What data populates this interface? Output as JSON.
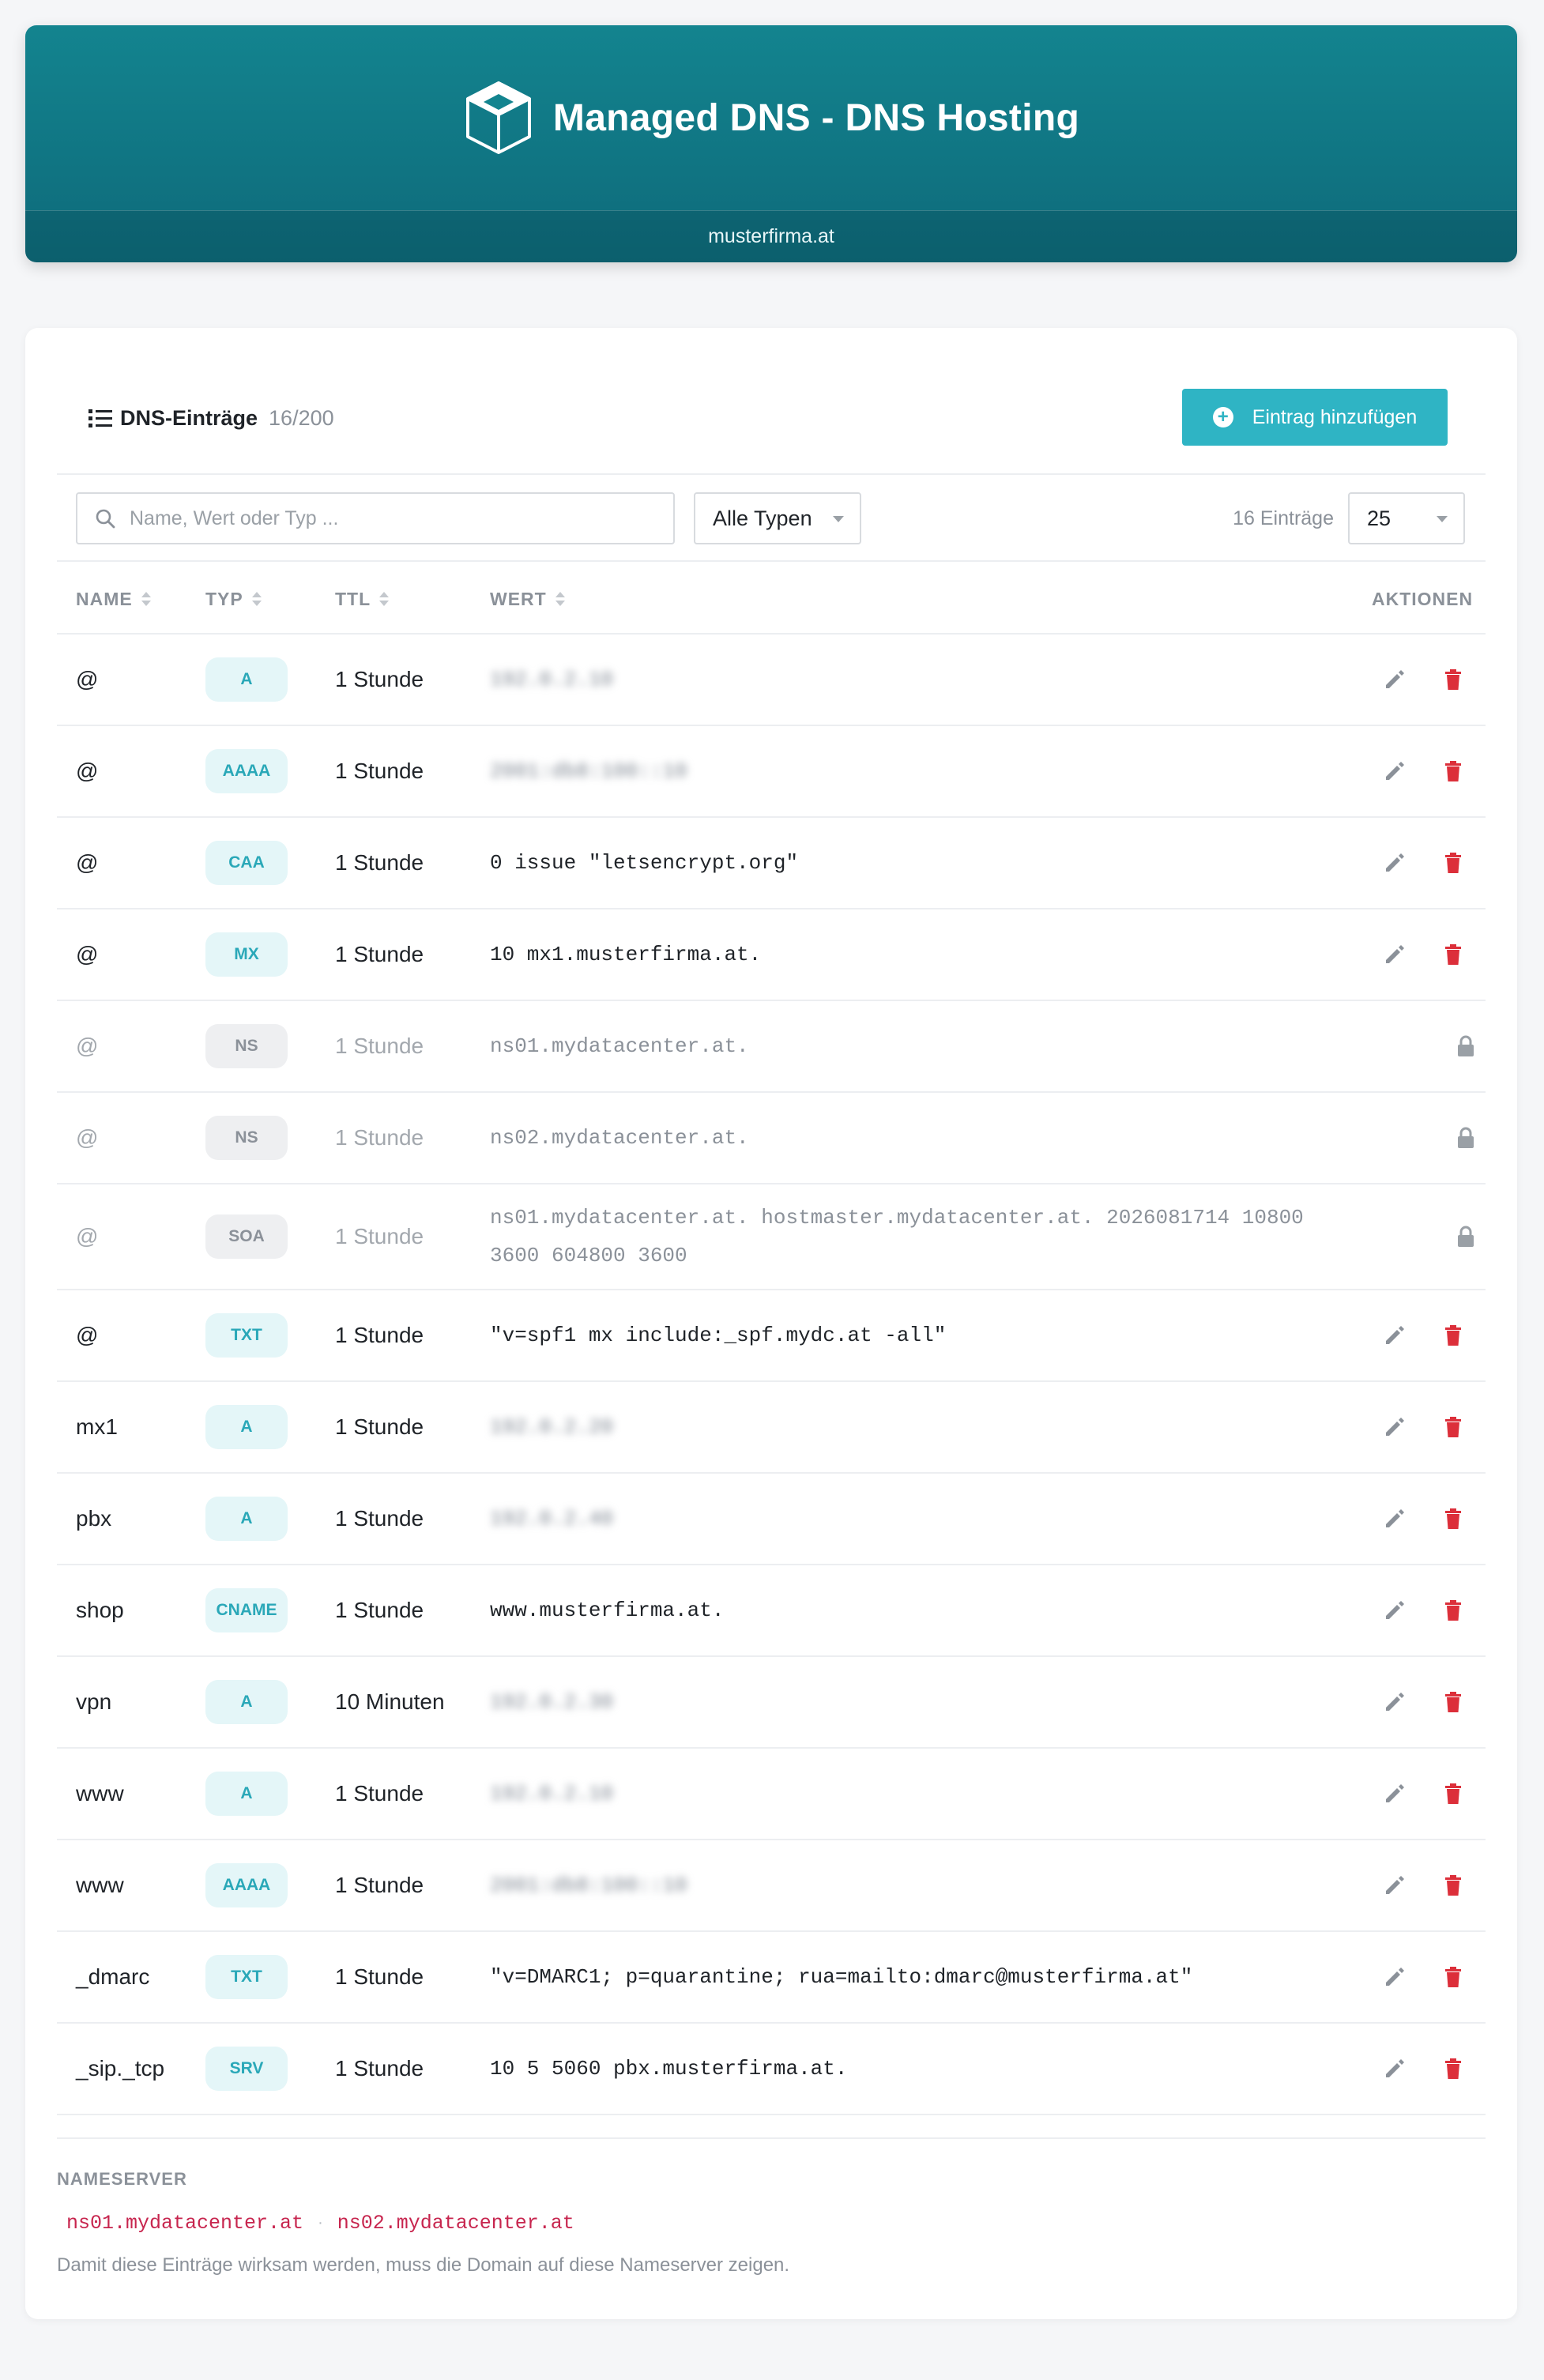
{
  "header": {
    "title": "Managed DNS - DNS Hosting",
    "domain": "musterfirma.at"
  },
  "card": {
    "title": "DNS-Einträge",
    "count": "16/200",
    "add_button": "Eintrag hinzufügen"
  },
  "filters": {
    "search_placeholder": "Name, Wert oder Typ ...",
    "type_select": "Alle Typen",
    "entries_label": "16 Einträge",
    "page_size": "25"
  },
  "table": {
    "columns": [
      "NAME",
      "TYP",
      "TTL",
      "WERT",
      "AKTIONEN"
    ],
    "rows": [
      {
        "name": "@",
        "type": "A",
        "ttl": "1 Stunde",
        "value": "192.0.2.10",
        "blurred": true,
        "locked": false
      },
      {
        "name": "@",
        "type": "AAAA",
        "ttl": "1 Stunde",
        "value": "2001:db8:100::10",
        "blurred": true,
        "locked": false
      },
      {
        "name": "@",
        "type": "CAA",
        "ttl": "1 Stunde",
        "value": "0 issue \"letsencrypt.org\"",
        "blurred": false,
        "locked": false
      },
      {
        "name": "@",
        "type": "MX",
        "ttl": "1 Stunde",
        "value": "10 mx1.musterfirma.at.",
        "blurred": false,
        "locked": false
      },
      {
        "name": "@",
        "type": "NS",
        "ttl": "1 Stunde",
        "value": "ns01.mydatacenter.at.",
        "blurred": false,
        "locked": true
      },
      {
        "name": "@",
        "type": "NS",
        "ttl": "1 Stunde",
        "value": "ns02.mydatacenter.at.",
        "blurred": false,
        "locked": true
      },
      {
        "name": "@",
        "type": "SOA",
        "ttl": "1 Stunde",
        "value": "ns01.mydatacenter.at. hostmaster.mydatacenter.at. 2026081714 10800 3600 604800 3600",
        "blurred": false,
        "locked": true
      },
      {
        "name": "@",
        "type": "TXT",
        "ttl": "1 Stunde",
        "value": "\"v=spf1 mx include:_spf.mydc.at -all\"",
        "blurred": false,
        "locked": false
      },
      {
        "name": "mx1",
        "type": "A",
        "ttl": "1 Stunde",
        "value": "192.0.2.20",
        "blurred": true,
        "locked": false
      },
      {
        "name": "pbx",
        "type": "A",
        "ttl": "1 Stunde",
        "value": "192.0.2.40",
        "blurred": true,
        "locked": false
      },
      {
        "name": "shop",
        "type": "CNAME",
        "ttl": "1 Stunde",
        "value": "www.musterfirma.at.",
        "blurred": false,
        "locked": false
      },
      {
        "name": "vpn",
        "type": "A",
        "ttl": "10 Minuten",
        "value": "192.0.2.30",
        "blurred": true,
        "locked": false
      },
      {
        "name": "www",
        "type": "A",
        "ttl": "1 Stunde",
        "value": "192.0.2.10",
        "blurred": true,
        "locked": false
      },
      {
        "name": "www",
        "type": "AAAA",
        "ttl": "1 Stunde",
        "value": "2001:db8:100::10",
        "blurred": true,
        "locked": false
      },
      {
        "name": "_dmarc",
        "type": "TXT",
        "ttl": "1 Stunde",
        "value": "\"v=DMARC1; p=quarantine; rua=mailto:dmarc@musterfirma.at\"",
        "blurred": false,
        "locked": false
      },
      {
        "name": "_sip._tcp",
        "type": "SRV",
        "ttl": "1 Stunde",
        "value": "10 5 5060 pbx.musterfirma.at.",
        "blurred": false,
        "locked": false
      }
    ]
  },
  "nameserver": {
    "title": "NAMESERVER",
    "servers": [
      "ns01.mydatacenter.at",
      "ns02.mydatacenter.at"
    ],
    "separator": "·",
    "note": "Damit diese Einträge wirksam werden, muss die Domain auf diese Nameserver zeigen."
  },
  "colors": {
    "header_top": "#13848f",
    "header_bottom": "#0e6a7a",
    "accent": "#2fb4c4",
    "badge_bg": "#e4f6f8",
    "badge_text": "#2aa8b8",
    "delete": "#dc2f3a",
    "edit": "#8b9199",
    "nameserver_text": "#c7254e"
  },
  "icons": {
    "logo": "cube-icon",
    "list": "list-icon",
    "add": "plus-circle-icon",
    "search": "search-icon",
    "sort": "sort-icon",
    "edit": "pencil-icon",
    "delete": "trash-icon",
    "locked": "lock-icon"
  }
}
